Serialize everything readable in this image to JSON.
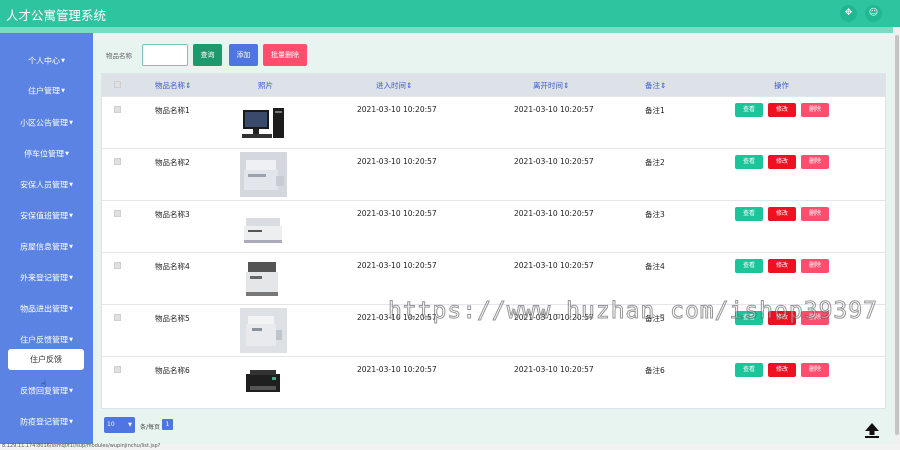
{
  "app": {
    "title": "人才公寓管理系统"
  },
  "sidebar": {
    "items": [
      {
        "label": "个人中心"
      },
      {
        "label": "住户管理"
      },
      {
        "label": "小区公告管理"
      },
      {
        "label": "停车位管理"
      },
      {
        "label": "安保人员管理"
      },
      {
        "label": "安保值班管理"
      },
      {
        "label": "房屋信息管理"
      },
      {
        "label": "外来登记管理"
      },
      {
        "label": "物品进出管理"
      },
      {
        "label": "住户反馈管理"
      },
      {
        "label": "反馈回复管理"
      },
      {
        "label": "防疫登记管理"
      }
    ],
    "sub_item": "住户反馈"
  },
  "toolbar": {
    "search_label": "物品名称",
    "query_label": "查询",
    "add_label": "添加",
    "batch_delete_label": "批量删除"
  },
  "table": {
    "headers": [
      "物品名称⇕",
      "照片",
      "进入时间⇕",
      "离开时间⇕",
      "备注⇕",
      "操作"
    ],
    "rows": [
      {
        "name": "物品名称1",
        "enter": "2021-03-10 10:20:57",
        "leave": "2021-03-10 10:20:57",
        "note": "备注1"
      },
      {
        "name": "物品名称2",
        "enter": "2021-03-10 10:20:57",
        "leave": "2021-03-10 10:20:57",
        "note": "备注2"
      },
      {
        "name": "物品名称3",
        "enter": "2021-03-10 10:20:57",
        "leave": "2021-03-10 10:20:57",
        "note": "备注3"
      },
      {
        "name": "物品名称4",
        "enter": "2021-03-10 10:20:57",
        "leave": "2021-03-10 10:20:57",
        "note": "备注4"
      },
      {
        "name": "物品名称5",
        "enter": "2021-03-10 10:20:57",
        "leave": "2021-03-10 10:20:57",
        "note": "备注5"
      },
      {
        "name": "物品名称6",
        "enter": "2021-03-10 10:20:57",
        "leave": "2021-03-10 10:20:57",
        "note": "备注6"
      }
    ],
    "actions": {
      "view": "查看",
      "edit": "修改",
      "delete": "删除"
    }
  },
  "pager": {
    "page_size": "10",
    "per_page_label": "条/每页",
    "current_page": "1"
  },
  "status_url": "8.129.11.174:8016/ssmq0t1l/sup/modules/wupinjinchu/list.jsp?",
  "watermark": "https://www.huzhan.com/ishop39397",
  "icons": {
    "top_left": "expand-icon",
    "top_right": "user-icon",
    "scroll_top": "arrow-up-icon"
  },
  "colors": {
    "topbar": "#2ec4a0",
    "sidebar": "#5a83e3",
    "query": "#1d9a6c",
    "add": "#4f76e0",
    "danger": "#ff4d6d",
    "edit": "#ee1122",
    "view": "#1cc49a"
  }
}
